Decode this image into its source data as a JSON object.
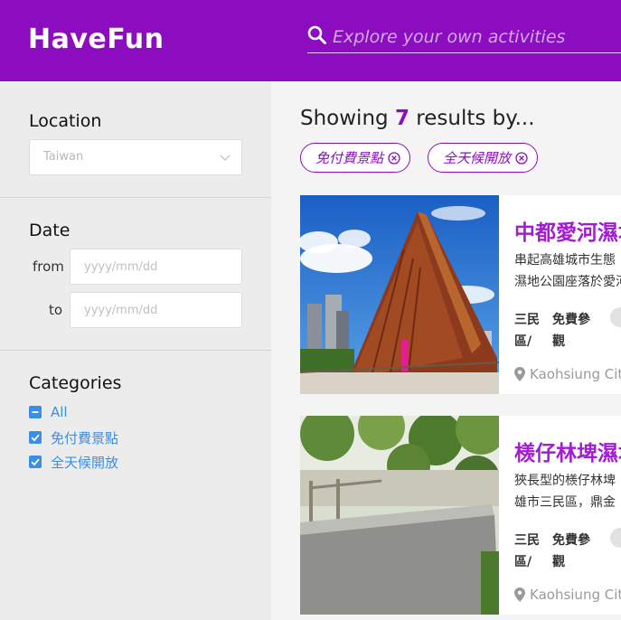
{
  "app": {
    "logo": "HaveFun"
  },
  "search": {
    "placeholder": "Explore your own activities"
  },
  "sidebar": {
    "location": {
      "title": "Location",
      "selected": "Taiwan"
    },
    "date": {
      "title": "Date",
      "from_label": "from",
      "to_label": "to",
      "from_placeholder": "yyyy/mm/dd",
      "to_placeholder": "yyyy/mm/dd"
    },
    "categories": {
      "title": "Categories",
      "items": [
        {
          "label": "All",
          "state": "indeterminate"
        },
        {
          "label": "免付費景點",
          "state": "checked"
        },
        {
          "label": "全天候開放",
          "state": "checked"
        }
      ]
    }
  },
  "results": {
    "prefix": "Showing",
    "count": "7",
    "suffix": "results by...",
    "tags": [
      "免付費景點",
      "全天候開放"
    ]
  },
  "cards": [
    {
      "title": "中都愛河濕地公園",
      "desc_line1": "串起高雄城市生態",
      "desc_line2": "濕地公園座落於愛河",
      "district": "三民區/",
      "fee": "免費參觀",
      "location": "Kaohsiung City"
    },
    {
      "title": "檨仔林埤濕地公園",
      "desc_line1": "狹長型的檨仔林埤",
      "desc_line2": "雄市三民區，鼎金",
      "district": "三民區/",
      "fee": "免費參觀",
      "location": "Kaohsiung City"
    }
  ],
  "colors": {
    "brand": "#8c0dbf",
    "accent": "#a21cd1",
    "link": "#3a8ee6"
  }
}
